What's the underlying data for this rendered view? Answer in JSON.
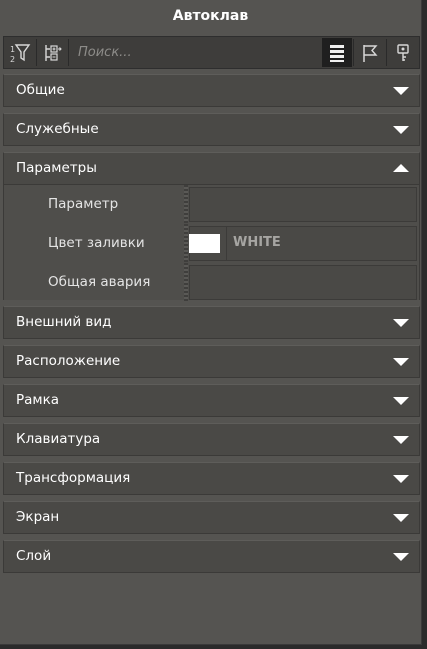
{
  "panel": {
    "title": "Автоклав"
  },
  "toolbar": {
    "search_placeholder": "Поиск...",
    "buttons": [
      "sort-icon",
      "expand-tree-icon",
      "list-view-icon",
      "flag-icon",
      "key-icon"
    ]
  },
  "sections": [
    {
      "label": "Общие",
      "expanded": false
    },
    {
      "label": "Служебные",
      "expanded": false
    },
    {
      "label": "Параметры",
      "expanded": true
    },
    {
      "label": "Внешний вид",
      "expanded": false
    },
    {
      "label": "Расположение",
      "expanded": false
    },
    {
      "label": "Рамка",
      "expanded": false
    },
    {
      "label": "Клавиатура",
      "expanded": false
    },
    {
      "label": "Трансформация",
      "expanded": false
    },
    {
      "label": "Экран",
      "expanded": false
    },
    {
      "label": "Слой",
      "expanded": false
    }
  ],
  "params": {
    "parameter": {
      "label": "Параметр",
      "value": ""
    },
    "fill_color": {
      "label": "Цвет заливки",
      "value": "WHITE",
      "swatch": "#ffffff"
    },
    "general_alarm": {
      "label": "Общая авария",
      "value": ""
    }
  }
}
